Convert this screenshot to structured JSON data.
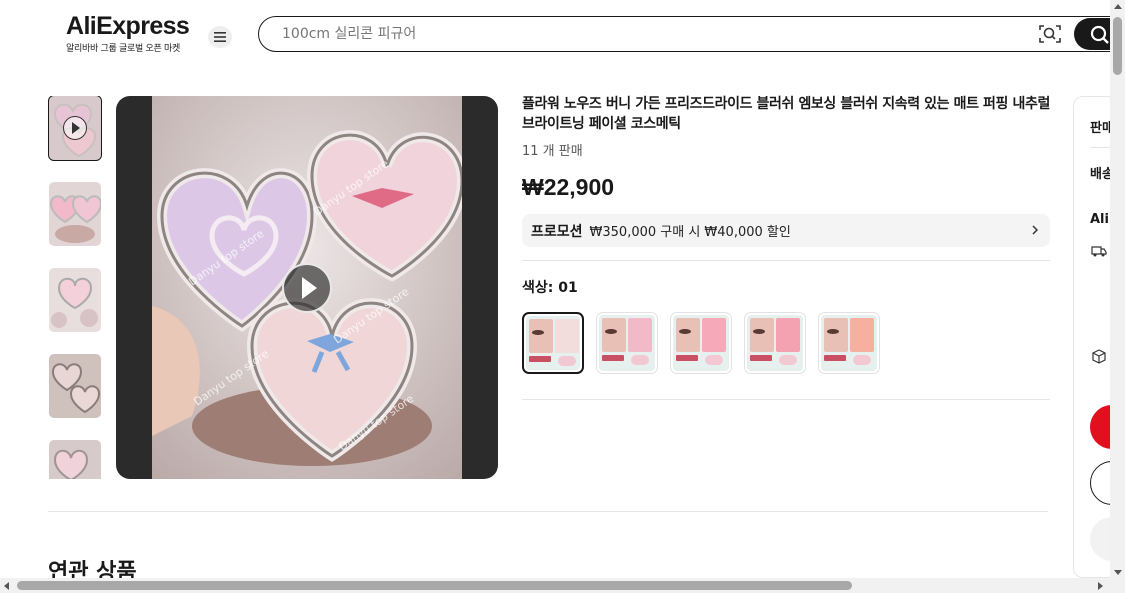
{
  "header": {
    "logo_text": "AliExpress",
    "logo_subtitle": "알리바바 그룹 글로벌 오픈 마켓",
    "search_placeholder": "100cm 실리콘 피규어"
  },
  "product": {
    "title": "플라워 노우즈 버니 가든 프리즈드라이드 블러쉬 엠보싱 블러쉬 지속력 있는 매트 퍼핑 내추럴 브라이트닝 페이셜 코스메틱",
    "sold": "11 개 판매",
    "price": "₩22,900",
    "promotion": {
      "label": "프로모션",
      "text": "₩350,000 구매 시 ₩40,000 할인"
    },
    "color_label": "색상: 01",
    "swatches": [
      {
        "blush": "#f3dcdc"
      },
      {
        "blush": "#f2b9c8"
      },
      {
        "blush": "#f6a9b9"
      },
      {
        "blush": "#f4a1b2"
      },
      {
        "blush": "#f7b0a0"
      }
    ]
  },
  "watermarks": [
    "Danyu top store",
    "Danyu top store",
    "Danyu top store",
    "Danyu top store",
    "Danyu top store"
  ],
  "right_panel": {
    "seller_label": "판매",
    "shipping_label": "배송",
    "brand_label": "AliE"
  },
  "related_heading": "연관 상품",
  "colors": {
    "accent_red": "#e0101f",
    "text_primary": "#191919",
    "promo_bg": "#f4f4f4"
  }
}
